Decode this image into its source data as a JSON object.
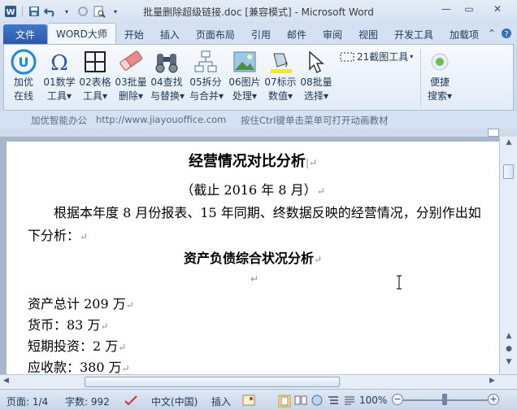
{
  "window": {
    "title": "批量删除超级链接.doc [兼容模式]  -  Microsoft Word"
  },
  "tabs": [
    {
      "label": "文件"
    },
    {
      "label": "WORD大师"
    },
    {
      "label": "开始"
    },
    {
      "label": "插入"
    },
    {
      "label": "页面布局"
    },
    {
      "label": "引用"
    },
    {
      "label": "邮件"
    },
    {
      "label": "审阅"
    },
    {
      "label": "视图"
    },
    {
      "label": "开发工具"
    },
    {
      "label": "加载项"
    }
  ],
  "ribbon": {
    "buttons": [
      {
        "l1": "加优",
        "l2": "在线"
      },
      {
        "l1": "01数学",
        "l2": "工具▾"
      },
      {
        "l1": "02表格",
        "l2": "工具▾"
      },
      {
        "l1": "03批量",
        "l2": "删除▾"
      },
      {
        "l1": "04查找",
        "l2": "与替换▾"
      },
      {
        "l1": "05拆分",
        "l2": "与合并▾"
      },
      {
        "l1": "06图片",
        "l2": "处理▾"
      },
      {
        "l1": "07标示",
        "l2": "数值▾"
      },
      {
        "l1": "08批量",
        "l2": "选择▾"
      }
    ],
    "screenshot_tool": "21截图工具",
    "quick_search": {
      "l1": "便捷",
      "l2": "搜索▾"
    }
  },
  "infobar": {
    "brand": "加优智能办公",
    "url": "http://www.jiayouoffice.com",
    "hint": "按住Ctrl键单击菜单可打开动画教材"
  },
  "document": {
    "title": "经营情况对比分析",
    "subtitle": "（截止 2016 年 8 月）",
    "paragraph": "根据本年度 8 月份报表、15 年同期、终数据反映的经营情况，分别作出如下分析：",
    "heading2": "资产负债综合状况分析",
    "lines": [
      "资产总计 209 万",
      "货币：83 万",
      "短期投资：2 万",
      "应收款：380 万"
    ]
  },
  "statusbar": {
    "page": "页面: 1/4",
    "words": "字数: 992",
    "language": "中文(中国)",
    "mode": "插入",
    "zoom": "100%"
  },
  "colors": {
    "file_tab": "#2a5aa8",
    "ribbon_bg": "#e2ebf6"
  }
}
